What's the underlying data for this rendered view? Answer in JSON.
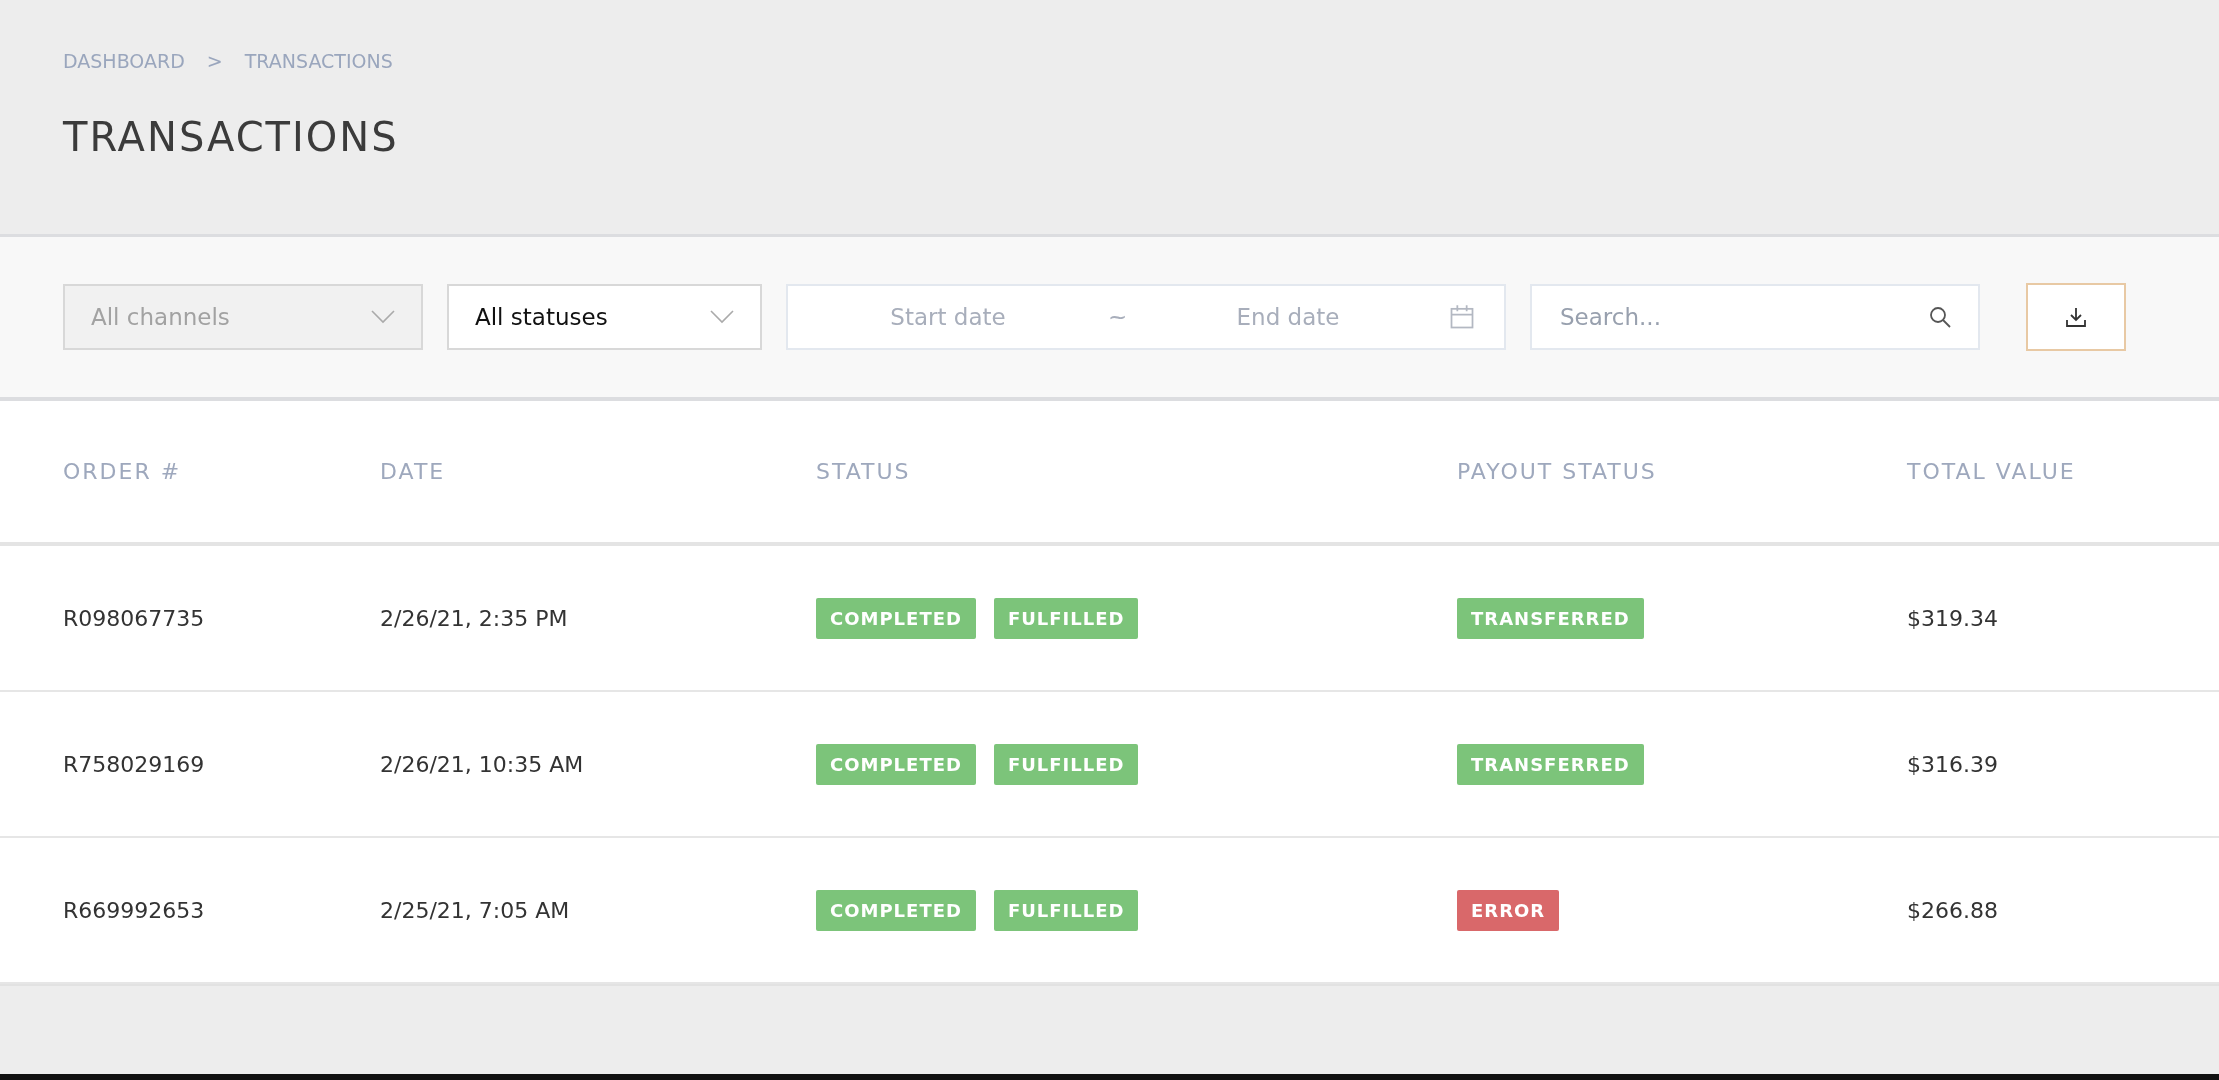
{
  "breadcrumb": [
    "DASHBOARD",
    "TRANSACTIONS"
  ],
  "breadcrumb_separator": ">",
  "page_title": "TRANSACTIONS",
  "filters": {
    "dropdowns": [
      {
        "value": "All channels",
        "disabled": true
      },
      {
        "value": "All statuses",
        "disabled": false
      }
    ],
    "date_range": {
      "start_placeholder": "Start date",
      "separator": "~",
      "end_placeholder": "End date"
    },
    "search": {
      "placeholder": "Search..."
    }
  },
  "table": {
    "columns": [
      "ORDER #",
      "DATE",
      "STATUS",
      "PAYOUT STATUS",
      "TOTAL VALUE"
    ],
    "rows": [
      {
        "order": "R098067735",
        "date": "2/26/21, 2:35 PM",
        "status": [
          {
            "label": "COMPLETED",
            "color": "#7cc47a"
          },
          {
            "label": "FULFILLED",
            "color": "#7cc47a"
          }
        ],
        "payout": [
          {
            "label": "TRANSFERRED",
            "color": "#7cc47a"
          }
        ],
        "total": "$319.34"
      },
      {
        "order": "R758029169",
        "date": "2/26/21, 10:35 AM",
        "status": [
          {
            "label": "COMPLETED",
            "color": "#7cc47a"
          },
          {
            "label": "FULFILLED",
            "color": "#7cc47a"
          }
        ],
        "payout": [
          {
            "label": "TRANSFERRED",
            "color": "#7cc47a"
          }
        ],
        "total": "$316.39"
      },
      {
        "order": "R669992653",
        "date": "2/25/21, 7:05 AM",
        "status": [
          {
            "label": "COMPLETED",
            "color": "#7cc47a"
          },
          {
            "label": "FULFILLED",
            "color": "#7cc47a"
          }
        ],
        "payout": [
          {
            "label": "ERROR",
            "color": "#d9686a"
          }
        ],
        "total": "$266.88"
      }
    ]
  }
}
